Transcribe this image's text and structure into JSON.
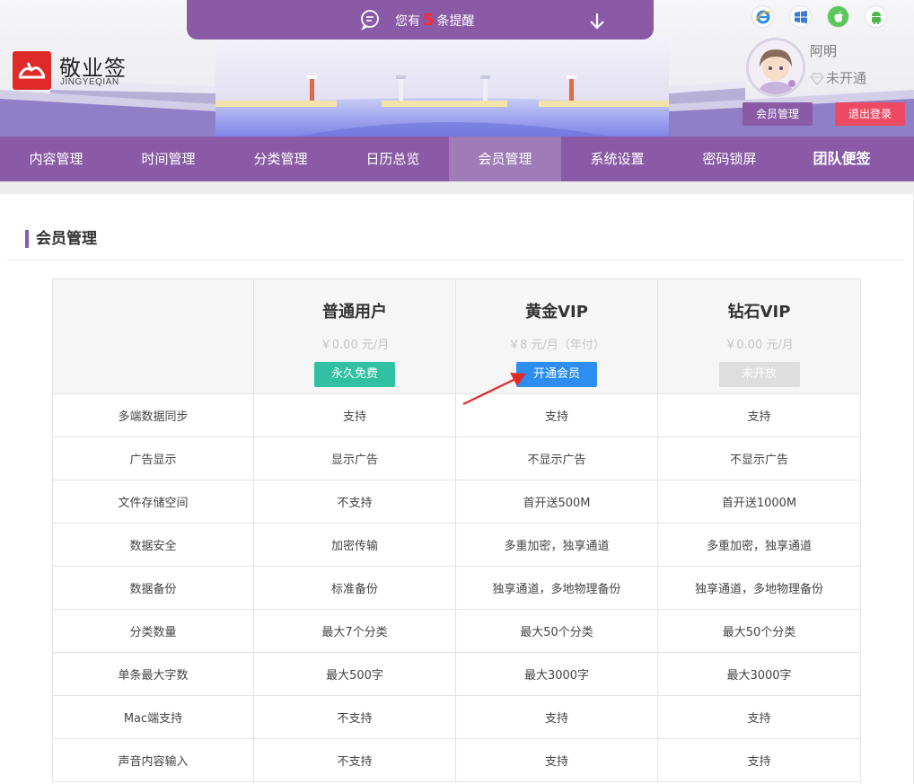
{
  "header": {
    "brand": "敬业签",
    "brand_sub": "JINGYEQIAN",
    "notice": {
      "prefix": "您有",
      "count": "5",
      "suffix": "条提醒"
    },
    "platforms": [
      "ie-icon",
      "windows-icon",
      "apple-icon",
      "android-icon"
    ],
    "user": {
      "name": "阿明",
      "vip_status": "未开通"
    },
    "member_button": "会员管理",
    "logout_button": "退出登录"
  },
  "nav": {
    "items": [
      "内容管理",
      "时间管理",
      "分类管理",
      "日历总览",
      "会员管理",
      "系统设置",
      "密码锁屏",
      "团队便签"
    ],
    "active_index": 4
  },
  "main": {
    "title": "会员管理",
    "plans": [
      {
        "name": "普通用户",
        "price": "￥0.00 元/月",
        "button": "永久免费"
      },
      {
        "name": "黄金VIP",
        "price": "￥8 元/月（年付）",
        "button": "开通会员"
      },
      {
        "name": "钻石VIP",
        "price": "￥0.00 元/月",
        "button": "未开放"
      }
    ],
    "rows": [
      {
        "feature": "多端数据同步",
        "values": [
          "支持",
          "支持",
          "支持"
        ]
      },
      {
        "feature": "广告显示",
        "values": [
          "显示广告",
          "不显示广告",
          "不显示广告"
        ]
      },
      {
        "feature": "文件存储空间",
        "values": [
          "不支持",
          "首开送500M",
          "首开送1000M"
        ]
      },
      {
        "feature": "数据安全",
        "values": [
          "加密传输",
          "多重加密，独享通道",
          "多重加密，独享通道"
        ]
      },
      {
        "feature": "数据备份",
        "values": [
          "标准备份",
          "独享通道，多地物理备份",
          "独享通道，多地物理备份"
        ]
      },
      {
        "feature": "分类数量",
        "values": [
          "最大7个分类",
          "最大50个分类",
          "最大50个分类"
        ]
      },
      {
        "feature": "单条最大字数",
        "values": [
          "最大500字",
          "最大3000字",
          "最大3000字"
        ]
      },
      {
        "feature": "Mac端支持",
        "values": [
          "不支持",
          "支持",
          "支持"
        ]
      },
      {
        "feature": "声音内容输入",
        "values": [
          "不支持",
          "支持",
          "支持"
        ]
      }
    ]
  },
  "colors": {
    "brand_purple": "#8a5aa6",
    "nav_active": "#9f7bb8",
    "logout_red": "#ec4a63",
    "free_green": "#32c0a2",
    "open_blue": "#2e8ef0",
    "annotation_red": "#e02a2a"
  }
}
